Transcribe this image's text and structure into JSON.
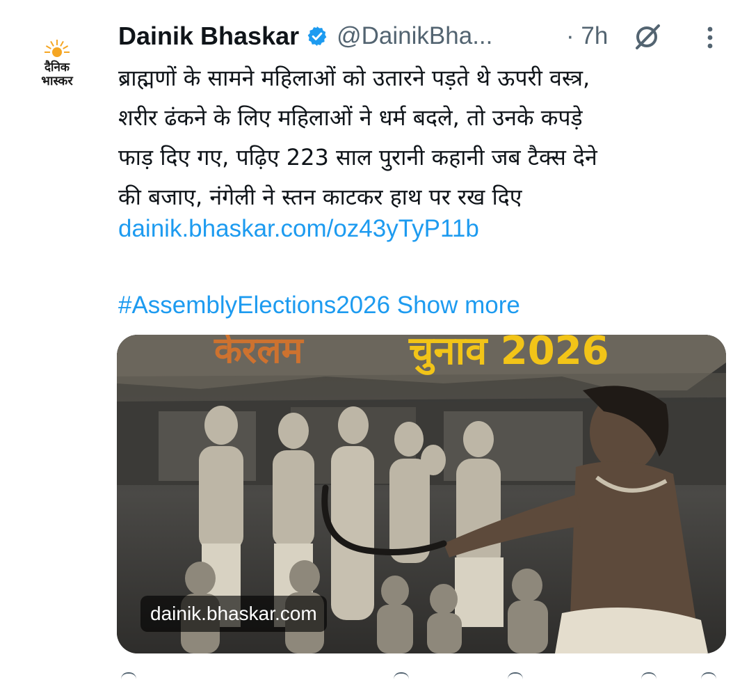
{
  "tweet": {
    "author": {
      "logo_line1": "दैनिक",
      "logo_line2": "भास्कर",
      "name": "Dainik Bhaskar",
      "handle": "@DainikBha...",
      "time": "· 7h"
    },
    "text_lines": [
      "ब्राह्मणों के सामने महिलाओं को उतारने पड़ते थे ऊपरी वस्त्र,",
      "शरीर ढंकने के लिए महिलाओं ने धर्म बदले, तो उनके कपड़े",
      "फाड़ दिए गए, पढ़िए 223 साल पुरानी कहानी जब टैक्स देने",
      "की बजाए, नंगेली ने स्तन काटकर हाथ पर रख दिए"
    ],
    "link": "dainik.bhaskar.com/oz43yTyP11b",
    "hashtag": "#AssemblyElections2026",
    "show_more": "Show more",
    "media": {
      "headline_left": "केरलम",
      "headline_right": "चुनाव 2026",
      "source_label": "dainik.bhaskar.com"
    }
  },
  "colors": {
    "text": "#0f1419",
    "secondary": "#536471",
    "link": "#1d9bf0",
    "logo_sun": "#f5a623"
  },
  "icons": [
    "verified-badge-icon",
    "grok-icon",
    "more-options-icon",
    "sun-logo-icon"
  ]
}
